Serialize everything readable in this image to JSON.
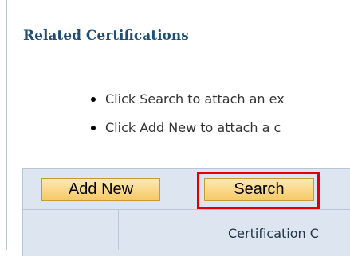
{
  "section": {
    "title": "Related Certifications"
  },
  "instructions": [
    "Click Search to attach an ex",
    "Click Add New to attach a c"
  ],
  "toolbar": {
    "add_new_label": "Add New",
    "search_label": "Search"
  },
  "table": {
    "columns": [
      "",
      "",
      "Certification C"
    ]
  },
  "colors": {
    "title": "#1f4e79",
    "button_top": "#fde9b2",
    "button_bottom": "#f6c965",
    "highlight": "#e00000",
    "grid_bg": "#dde6f0"
  }
}
